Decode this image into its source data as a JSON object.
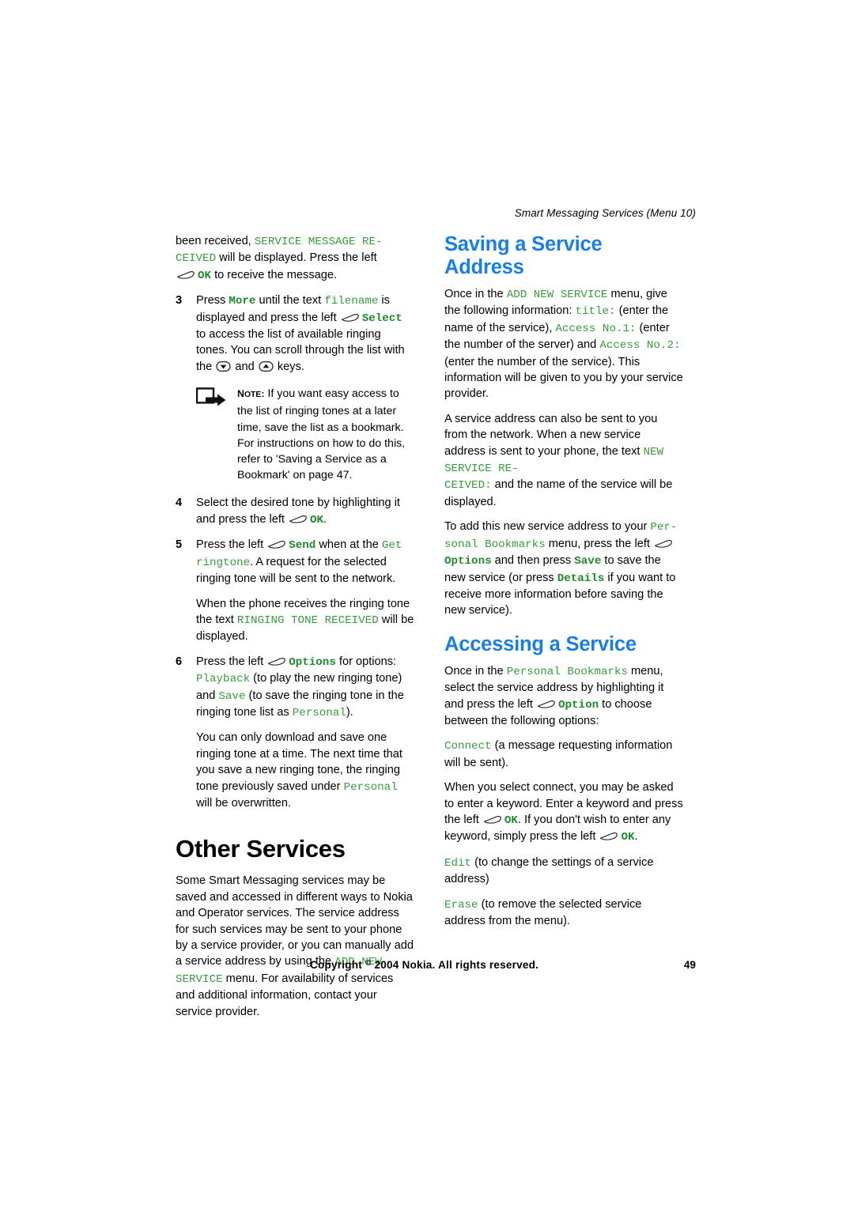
{
  "document": {
    "running_header": "Smart Messaging Services (Menu 10)",
    "page_number": "49",
    "copyright": "Copyright  2004 Nokia. All rights reserved.",
    "copyright_mark": "©",
    "accent_blue": "#1B7EE3",
    "accent_green": "#399B40",
    "accent_green_bold": "#1E8A2C"
  },
  "left_column": {
    "continued_paragraph": {
      "p1": "been received, ",
      "code1": "SERVICE MESSAGE RE-",
      "code2": "CEIVED",
      "p2": " will be displayed. Press the left",
      "softkey": "softkey-icon",
      "code3": "OK",
      "p3": " to receive the message."
    },
    "steps": [
      {
        "num": "3",
        "t1": "Press ",
        "c1": "More",
        "t2": " until the text ",
        "c2": "filename",
        "t3": " is displayed and press the left ",
        "c3": "Select",
        "t4": " to access the list of available ringing tones. You can scroll through the list with the ",
        "icon1": "arrow-down-key-icon",
        "t5": " and ",
        "icon2": "arrow-up-key-icon",
        "t6": " keys."
      },
      {
        "num": "4",
        "t1": "Select the desired tone by highlighting it and press the left ",
        "c1": "OK",
        "t2": "."
      },
      {
        "num": "5",
        "t1": "Press the left ",
        "c1": "Send",
        "t2": " when at the ",
        "c2": "Get ringtone",
        "t3": ". A request for the selected ringing tone will be sent to the network."
      },
      {
        "num": "6",
        "t1": "Press the left ",
        "c1": "Options",
        "t2": " for options: ",
        "c2": "Playback",
        "t3": " (to play the new ringing tone) and ",
        "c3": "Save",
        "t4": " (to save the ringing tone in the ringing tone list as ",
        "c4": "Personal",
        "t5": ")."
      }
    ],
    "note": {
      "label": "NOTE:",
      "label_n": "N",
      "label_ote": "OTE",
      "label_colon": ":",
      "text": " If you want easy access to the list of ringing tones at a later time, save the list as a bookmark. For instructions on how to do this, refer to 'Saving a Service as a Bookmark' on page 47.",
      "icon": "note-arrow-icon"
    },
    "ringing_tone_received": {
      "t1": "When the phone receives the ringing tone the text ",
      "c1": "RINGING TONE RECEIVED",
      "t2": " will be displayed."
    },
    "overwrite_paragraph": {
      "t1": "You can only download and save one ringing tone at a time. The next time that you save a new ringing tone, the ringing tone previously saved under ",
      "c1": "Personal",
      "t2": " will be overwritten."
    },
    "other_services": {
      "heading": "Other Services",
      "t1": "Some Smart Messaging services may be saved and accessed in different ways to Nokia and Operator services. The service address for such services may be sent to your phone by a service provider, or you can manually add a service address by using the ",
      "c1": "ADD NEW SERVICE",
      "t2": " menu. For availability of services and additional information, contact your service provider."
    }
  },
  "right_column": {
    "saving_heading": "Saving a Service Address",
    "saving_p1": {
      "t1": "Once in the ",
      "c1": "ADD NEW SERVICE",
      "t2": " menu, give the following information: ",
      "c2": "title:",
      "t3": " (enter the name of the service), ",
      "c3": "Access No.1:",
      "t4": " (enter the number of the server) and ",
      "c4": "Access No.2:",
      "t5": " (enter the number of the service). This information will be given to you by your service provider."
    },
    "saving_p2": {
      "t1": "A service address can also be sent to you from the network. When a new service address is sent to your phone, the text ",
      "c1": "NEW SERVICE RE-",
      "c2": "CEIVED:",
      "t2": " and the name of the service will be displayed."
    },
    "saving_p3": {
      "t1": "To add this new service address to your ",
      "c1": "Per-",
      "c2": "sonal Bookmarks",
      "t2": " menu, press the left ",
      "icon": "softkey-icon",
      "c3": "Options",
      "t3": " and then press ",
      "c4": "Save",
      "t4": " to save the new service (or press ",
      "c5": "Details",
      "t5": " if you want to receive more information before saving the new service)."
    },
    "accessing_heading": "Accessing a Service",
    "accessing_p1": {
      "t1": "Once in the ",
      "c1": "Personal Bookmarks",
      "t2": " menu, select the service address by highlighting it and press the left ",
      "icon": "softkey-icon",
      "c2": "Option",
      "t3": " to choose between the following options:"
    },
    "accessing_p2": {
      "c1": "Connect",
      "t1": " (a message requesting information will be sent)."
    },
    "accessing_p3": {
      "t1": "When you select connect, you may be asked to enter a keyword. Enter a keyword and press the left ",
      "c1": "OK",
      "t2": ". If you don't wish to enter any keyword, simply press the left ",
      "c2": "OK",
      "t3": "."
    },
    "accessing_p4": {
      "c1": "Edit",
      "t1": " (to change the settings of a service address)"
    },
    "accessing_p5": {
      "c1": "Erase",
      "t1": " (to remove the selected service address from the menu)."
    }
  }
}
